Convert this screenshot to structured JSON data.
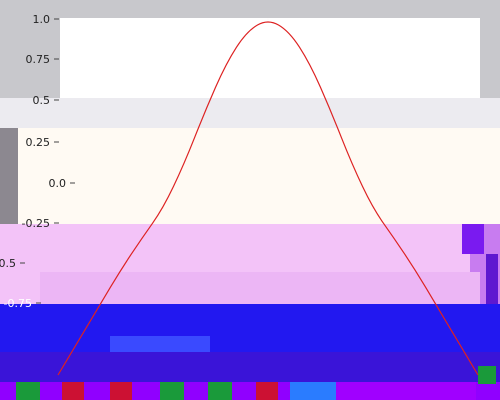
{
  "chart_data": {
    "type": "line",
    "title": "",
    "xlabel": "",
    "ylabel": "",
    "ylim": [
      -1.0,
      1.0
    ],
    "xlim": [
      -1.0,
      1.0
    ],
    "grid": false,
    "legend": "none",
    "y_tick_labels": [
      "1.0",
      "0.75",
      "0.5",
      "0.25",
      "0.0",
      "-0.25",
      "-0.5",
      "-0.75"
    ],
    "y_tick_values": [
      1.0,
      0.75,
      0.5,
      0.25,
      0.0,
      -0.25,
      -0.5,
      -0.75
    ],
    "series": [
      {
        "color": "#dd2222",
        "x": [
          -1.0,
          -0.9,
          -0.8,
          -0.7,
          -0.6,
          -0.5,
          -0.4,
          -0.3,
          -0.2,
          -0.1,
          0.0,
          0.1,
          0.2,
          0.3,
          0.4,
          0.5,
          0.6,
          0.7,
          0.8,
          0.9,
          1.0
        ],
        "values": [
          -1.0,
          -0.81,
          -0.62,
          -0.43,
          -0.26,
          -0.1,
          0.15,
          0.46,
          0.74,
          0.93,
          1.0,
          0.93,
          0.74,
          0.46,
          0.15,
          -0.1,
          -0.26,
          -0.43,
          -0.62,
          -0.81,
          -1.0
        ]
      }
    ]
  }
}
